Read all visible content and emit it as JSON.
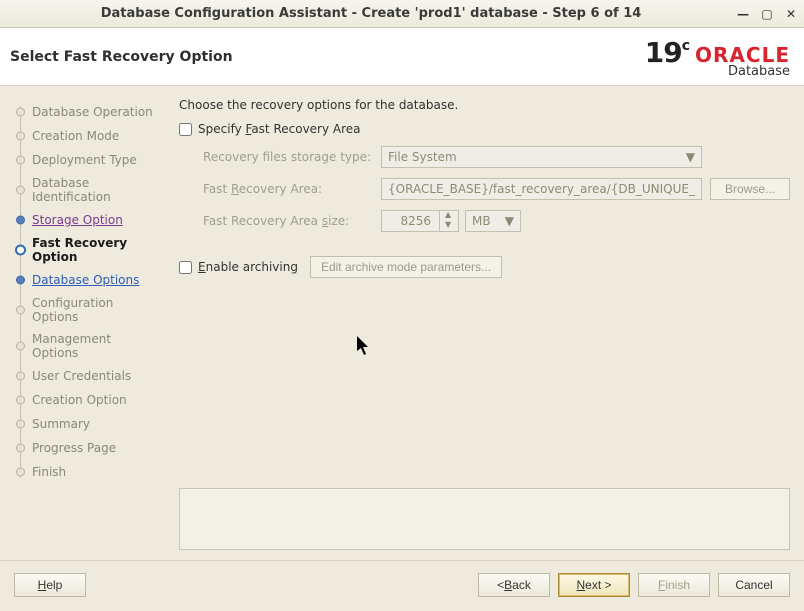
{
  "window": {
    "title": "Database Configuration Assistant - Create 'prod1' database - Step 6 of 14"
  },
  "header": {
    "page_title": "Select Fast Recovery Option",
    "logo_version": "19",
    "logo_suffix": "c",
    "logo_brand": "ORACLE",
    "logo_sub": "Database"
  },
  "sidebar": {
    "items": [
      {
        "label": "Database Operation",
        "state": "future"
      },
      {
        "label": "Creation Mode",
        "state": "future"
      },
      {
        "label": "Deployment Type",
        "state": "future"
      },
      {
        "label": "Database Identification",
        "state": "future"
      },
      {
        "label": "Storage Option",
        "state": "done"
      },
      {
        "label": "Fast Recovery Option",
        "state": "current"
      },
      {
        "label": "Database Options",
        "state": "next"
      },
      {
        "label": "Configuration Options",
        "state": "future"
      },
      {
        "label": "Management Options",
        "state": "future"
      },
      {
        "label": "User Credentials",
        "state": "future"
      },
      {
        "label": "Creation Option",
        "state": "future"
      },
      {
        "label": "Summary",
        "state": "future"
      },
      {
        "label": "Progress Page",
        "state": "future"
      },
      {
        "label": "Finish",
        "state": "future"
      }
    ]
  },
  "content": {
    "instruction": "Choose the recovery options for the database.",
    "specify_fra_label": "Specify Fast Recovery Area",
    "specify_fra_underline": "F",
    "storage_type_label": "Recovery files storage type:",
    "storage_type_value": "File System",
    "fra_label": "Fast Recovery Area:",
    "fra_underline": "R",
    "fra_value": "{ORACLE_BASE}/fast_recovery_area/{DB_UNIQUE_",
    "browse_label": "Browse...",
    "fra_size_label": "Fast Recovery Area size:",
    "fra_size_underline": "s",
    "fra_size_value": "8256",
    "fra_size_unit": "MB",
    "enable_arch_label": "Enable archiving",
    "enable_arch_underline": "E",
    "arch_params_btn": "Edit archive mode parameters..."
  },
  "footer": {
    "help": "Help",
    "back": "< Back",
    "next": "Next >",
    "finish": "Finish",
    "cancel": "Cancel"
  }
}
